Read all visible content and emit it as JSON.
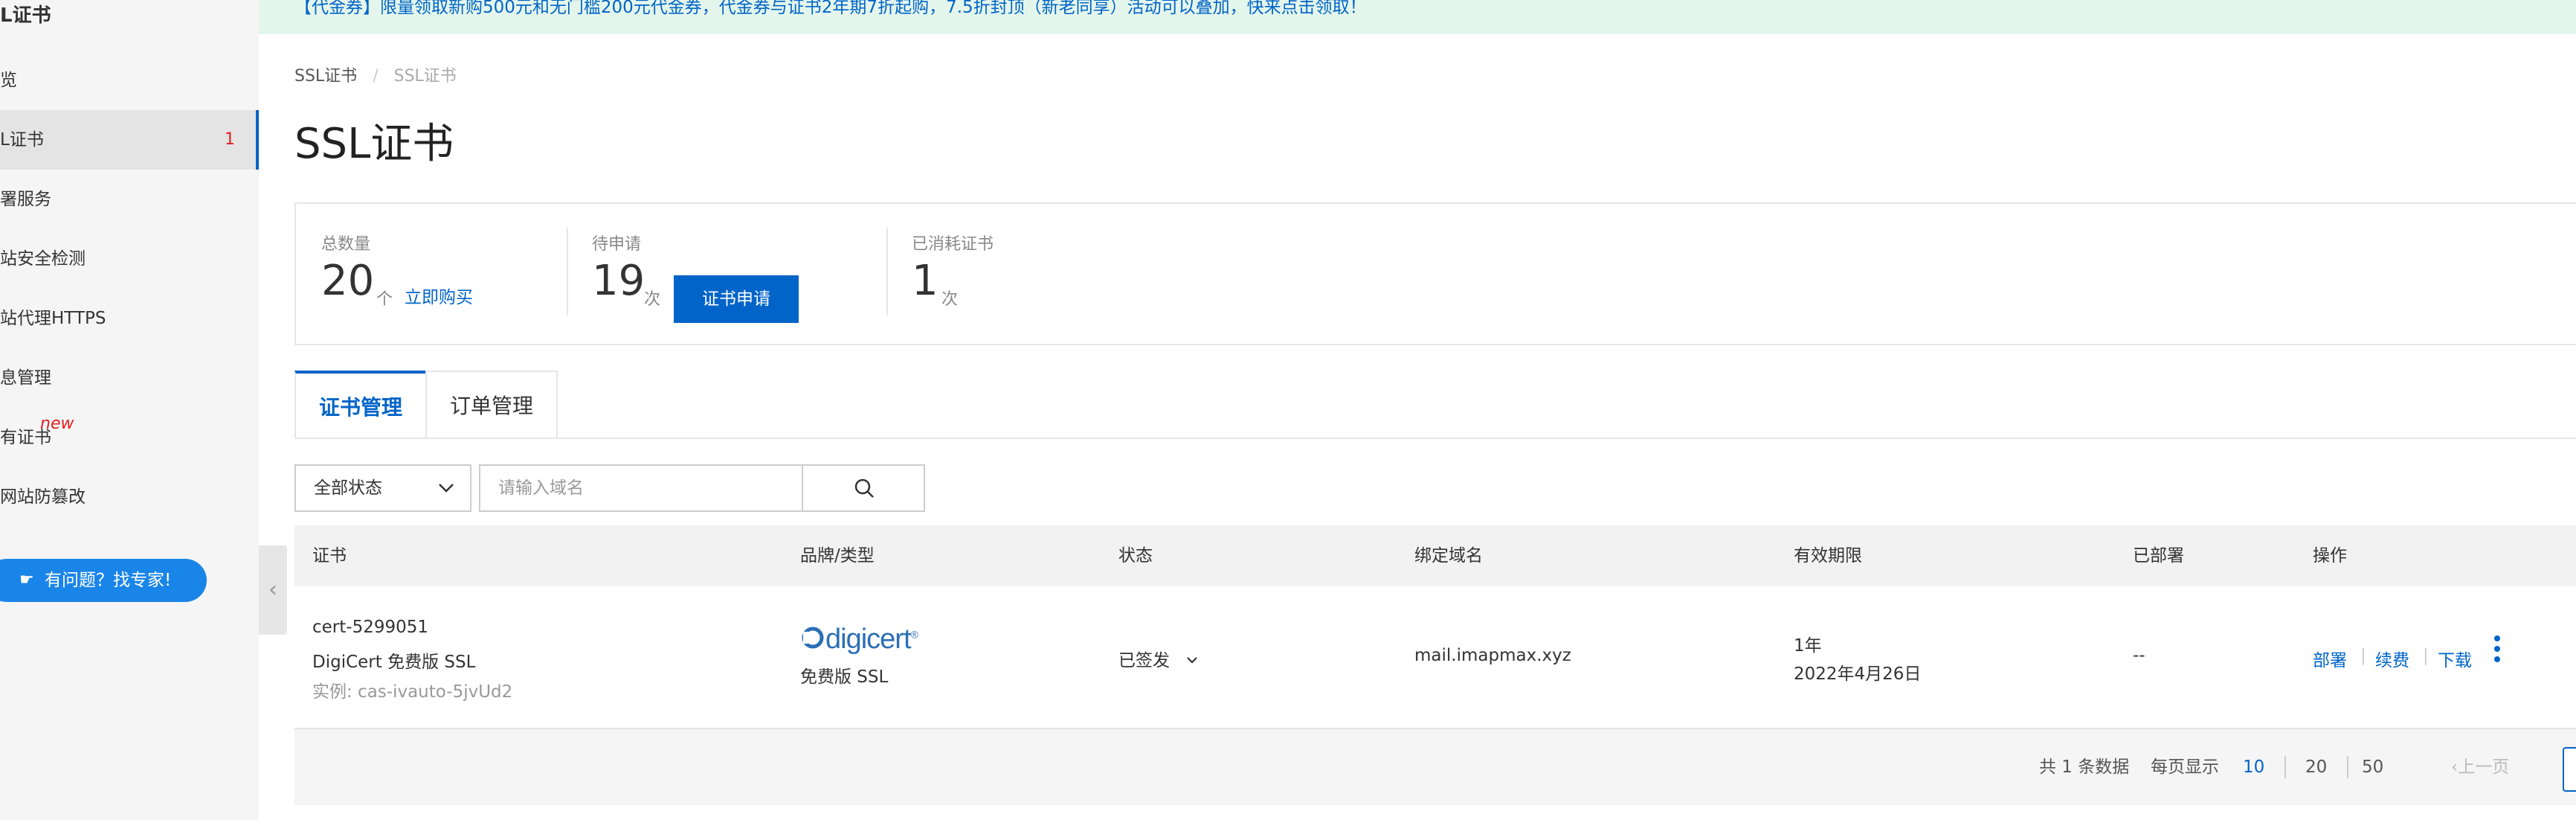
{
  "sidebar": {
    "title": "L证书",
    "items": [
      {
        "label": "览"
      },
      {
        "label": "L证书",
        "count": "1"
      },
      {
        "label": "署服务"
      },
      {
        "label": "站安全检测"
      },
      {
        "label": "站代理HTTPS"
      },
      {
        "label": "息管理"
      },
      {
        "label": "有证书",
        "badge": "new"
      },
      {
        "label": "网站防篡改"
      }
    ],
    "help_button": "有问题？找专家!"
  },
  "banner": {
    "text": "【代金券】限量领取新购500元和无门槛200元代金券，代金券与证书2年期7折起购，7.5折封顶（新老同享）活动可以叠加，快来点击领取！"
  },
  "breadcrumb": {
    "root": "SSL证书",
    "separator": "/",
    "current": "SSL证书"
  },
  "page_title": "SSL证书",
  "stats": {
    "total": {
      "label": "总数量",
      "value": "20",
      "unit": "个",
      "link": "立即购买"
    },
    "pending": {
      "label": "待申请",
      "value": "19",
      "unit": "次",
      "button": "证书申请"
    },
    "consumed": {
      "label": "已消耗证书",
      "value": "1",
      "unit": "次"
    }
  },
  "tabs": [
    {
      "label": "证书管理",
      "active": true
    },
    {
      "label": "订单管理",
      "active": false
    }
  ],
  "filters": {
    "status_select": "全部状态",
    "search_placeholder": "请输入域名",
    "search_value": ""
  },
  "table": {
    "columns": [
      "证书",
      "品牌/类型",
      "状态",
      "绑定域名",
      "有效期限",
      "已部署",
      "操作"
    ],
    "rows": [
      {
        "cert_id": "cert-5299051",
        "cert_name": "DigiCert 免费版 SSL",
        "instance": "实例: cas-ivauto-5jvUd2",
        "brand_logo": "digicert",
        "brand_type": "免费版 SSL",
        "status": "已签发",
        "domain": "mail.imapmax.xyz",
        "validity_term": "1年",
        "validity_date": "2022年4月26日",
        "deployed": "--",
        "actions": [
          "部署",
          "续费",
          "下载"
        ]
      }
    ]
  },
  "pagination": {
    "total": "共 1 条数据",
    "page_size_label": "每页显示",
    "sizes": [
      "10",
      "20",
      "50"
    ],
    "active_size": "10",
    "prev": "上一页"
  },
  "colors": {
    "accent": "#0064c8",
    "banner_bg": "#e4f6ec",
    "sidebar_bg": "#f5f5f5",
    "alert": "#e02020"
  },
  "icons": [
    "search-icon",
    "chevron-down-icon",
    "chevron-left-icon",
    "help-hand-icon",
    "more-vertical-icon"
  ]
}
